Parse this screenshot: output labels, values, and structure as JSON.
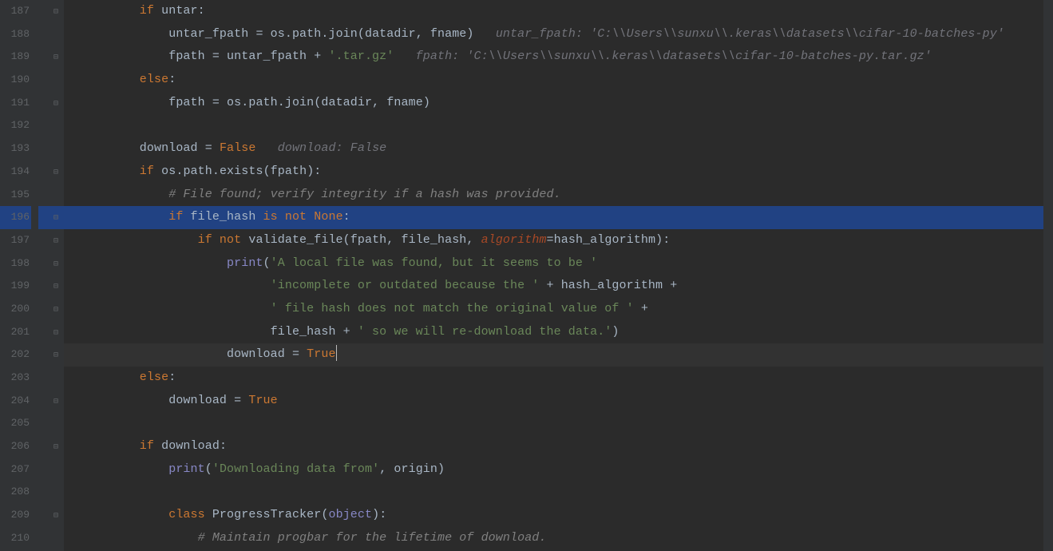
{
  "chart_data": null,
  "editor": {
    "first_line": 187,
    "highlighted_line": 196,
    "cursor_line": 202,
    "lines": [
      {
        "n": 187,
        "fold": "-",
        "seg": [
          [
            "kw",
            "        if "
          ],
          [
            "name",
            "untar"
          ],
          [
            "op",
            ":"
          ]
        ]
      },
      {
        "n": 188,
        "fold": "",
        "seg": [
          [
            "name",
            "            untar_fpath "
          ],
          [
            "op",
            "= "
          ],
          [
            "name",
            "os"
          ],
          [
            "op",
            "."
          ],
          [
            "name",
            "path"
          ],
          [
            "op",
            "."
          ],
          [
            "name",
            "join"
          ],
          [
            "par",
            "("
          ],
          [
            "name",
            "datadir"
          ],
          [
            "op",
            ", "
          ],
          [
            "name",
            "fname"
          ],
          [
            "par",
            ")   "
          ],
          [
            "hint",
            "untar_fpath: 'C:\\\\Users\\\\sunxu\\\\.keras\\\\datasets\\\\cifar-10-batches-py'"
          ]
        ]
      },
      {
        "n": 189,
        "fold": "-",
        "seg": [
          [
            "name",
            "            fpath "
          ],
          [
            "op",
            "= "
          ],
          [
            "name",
            "untar_fpath "
          ],
          [
            "op",
            "+ "
          ],
          [
            "str",
            "'.tar.gz'   "
          ],
          [
            "hint",
            "fpath: 'C:\\\\Users\\\\sunxu\\\\.keras\\\\datasets\\\\cifar-10-batches-py.tar.gz'"
          ]
        ]
      },
      {
        "n": 190,
        "fold": "",
        "seg": [
          [
            "kw",
            "        else"
          ],
          [
            "op",
            ":"
          ]
        ]
      },
      {
        "n": 191,
        "fold": "-",
        "seg": [
          [
            "name",
            "            fpath "
          ],
          [
            "op",
            "= "
          ],
          [
            "name",
            "os"
          ],
          [
            "op",
            "."
          ],
          [
            "name",
            "path"
          ],
          [
            "op",
            "."
          ],
          [
            "name",
            "join"
          ],
          [
            "par",
            "("
          ],
          [
            "name",
            "datadir"
          ],
          [
            "op",
            ", "
          ],
          [
            "name",
            "fname"
          ],
          [
            "par",
            ")"
          ]
        ]
      },
      {
        "n": 192,
        "fold": "",
        "seg": []
      },
      {
        "n": 193,
        "fold": "",
        "seg": [
          [
            "name",
            "        download "
          ],
          [
            "op",
            "= "
          ],
          [
            "bool",
            "False   "
          ],
          [
            "hint",
            "download: False"
          ]
        ]
      },
      {
        "n": 194,
        "fold": "-",
        "seg": [
          [
            "kw",
            "        if "
          ],
          [
            "name",
            "os"
          ],
          [
            "op",
            "."
          ],
          [
            "name",
            "path"
          ],
          [
            "op",
            "."
          ],
          [
            "name",
            "exists"
          ],
          [
            "par",
            "("
          ],
          [
            "name",
            "fpath"
          ],
          [
            "par",
            ")"
          ],
          [
            "op",
            ":"
          ]
        ]
      },
      {
        "n": 195,
        "fold": "",
        "seg": [
          [
            "cmt",
            "            # File found; verify integrity if a hash was provided."
          ]
        ]
      },
      {
        "n": 196,
        "fold": "-",
        "seg": [
          [
            "kw",
            "            if "
          ],
          [
            "name",
            "file_hash "
          ],
          [
            "kw",
            "is not "
          ],
          [
            "bool",
            "None"
          ],
          [
            "op",
            ":"
          ]
        ]
      },
      {
        "n": 197,
        "fold": "-",
        "seg": [
          [
            "kw",
            "                if not "
          ],
          [
            "name",
            "validate_file"
          ],
          [
            "par",
            "("
          ],
          [
            "name",
            "fpath"
          ],
          [
            "op",
            ", "
          ],
          [
            "name",
            "file_hash"
          ],
          [
            "op",
            ", "
          ],
          [
            "arg",
            "algorithm"
          ],
          [
            "op",
            "="
          ],
          [
            "name",
            "hash_algorithm"
          ],
          [
            "par",
            ")"
          ],
          [
            "op",
            ":"
          ]
        ]
      },
      {
        "n": 198,
        "fold": "-",
        "seg": [
          [
            "bi",
            "                    print"
          ],
          [
            "par",
            "("
          ],
          [
            "str",
            "'A local file was found, but it seems to be '"
          ]
        ]
      },
      {
        "n": 199,
        "fold": "-",
        "seg": [
          [
            "str",
            "                          'incomplete or outdated because the ' "
          ],
          [
            "op",
            "+ "
          ],
          [
            "name",
            "hash_algorithm "
          ],
          [
            "op",
            "+"
          ]
        ]
      },
      {
        "n": 200,
        "fold": "-",
        "seg": [
          [
            "str",
            "                          ' file hash does not match the original value of ' "
          ],
          [
            "op",
            "+"
          ]
        ]
      },
      {
        "n": 201,
        "fold": "-",
        "seg": [
          [
            "name",
            "                          file_hash "
          ],
          [
            "op",
            "+ "
          ],
          [
            "str",
            "' so we will re-download the data.'"
          ],
          [
            "par",
            ")"
          ]
        ]
      },
      {
        "n": 202,
        "fold": "-",
        "seg": [
          [
            "name",
            "                    download "
          ],
          [
            "op",
            "= "
          ],
          [
            "bool",
            "True"
          ]
        ],
        "cursor_after": true
      },
      {
        "n": 203,
        "fold": "",
        "seg": [
          [
            "kw",
            "        else"
          ],
          [
            "op",
            ":"
          ]
        ]
      },
      {
        "n": 204,
        "fold": "-",
        "seg": [
          [
            "name",
            "            download "
          ],
          [
            "op",
            "= "
          ],
          [
            "bool",
            "True"
          ]
        ]
      },
      {
        "n": 205,
        "fold": "",
        "seg": []
      },
      {
        "n": 206,
        "fold": "-",
        "seg": [
          [
            "kw",
            "        if "
          ],
          [
            "name",
            "download"
          ],
          [
            "op",
            ":"
          ]
        ]
      },
      {
        "n": 207,
        "fold": "",
        "seg": [
          [
            "bi",
            "            print"
          ],
          [
            "par",
            "("
          ],
          [
            "str",
            "'Downloading data from'"
          ],
          [
            "op",
            ", "
          ],
          [
            "name",
            "origin"
          ],
          [
            "par",
            ")"
          ]
        ]
      },
      {
        "n": 208,
        "fold": "",
        "seg": []
      },
      {
        "n": 209,
        "fold": "-",
        "seg": [
          [
            "kw",
            "            class "
          ],
          [
            "def",
            "ProgressTracker"
          ],
          [
            "par",
            "("
          ],
          [
            "bi",
            "object"
          ],
          [
            "par",
            ")"
          ],
          [
            "op",
            ":"
          ]
        ]
      },
      {
        "n": 210,
        "fold": "",
        "seg": [
          [
            "cmt",
            "                # Maintain progbar for the lifetime of download."
          ]
        ]
      }
    ]
  }
}
